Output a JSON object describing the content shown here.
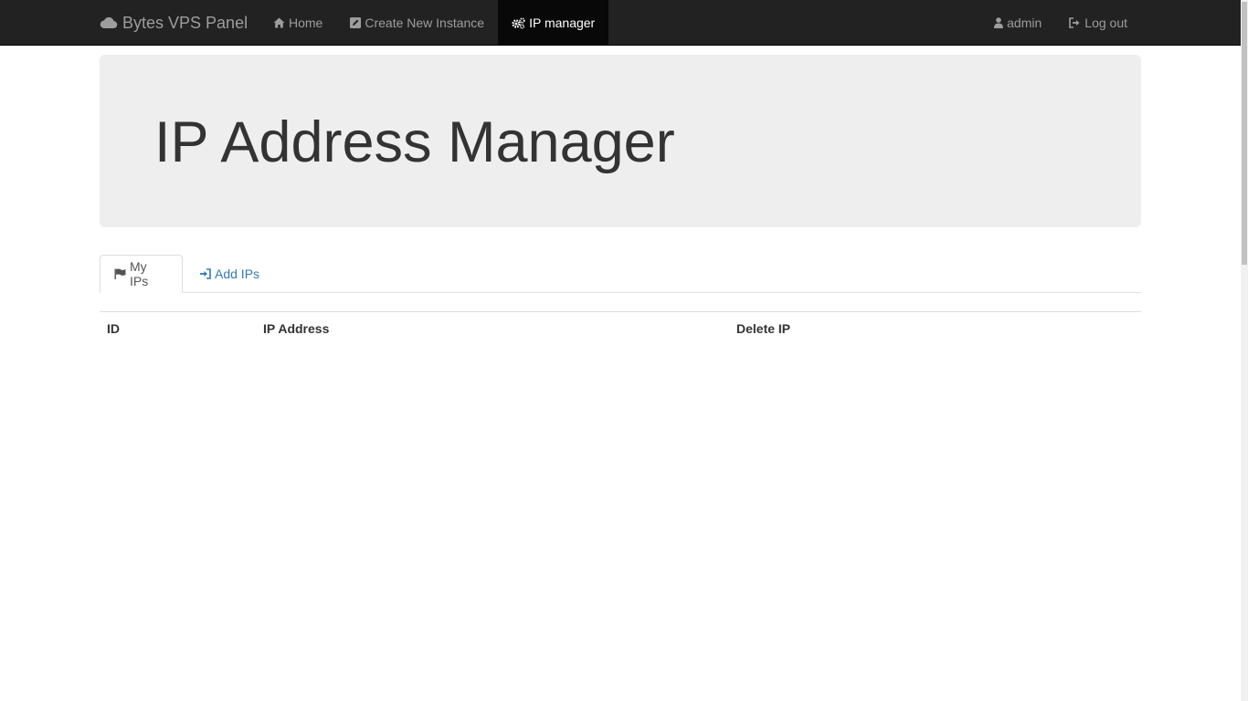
{
  "navbar": {
    "brand": "Bytes VPS Panel",
    "brand_icon": "cloud-icon",
    "left_items": [
      {
        "label": "Home",
        "icon": "home-icon",
        "active": false
      },
      {
        "label": "Create New Instance",
        "icon": "edit-icon",
        "active": false
      },
      {
        "label": "IP manager",
        "icon": "cogs-icon",
        "active": true
      }
    ],
    "right_items": [
      {
        "label": "admin",
        "icon": "user-icon"
      },
      {
        "label": "Log out",
        "icon": "log-out-icon"
      }
    ]
  },
  "jumbotron": {
    "title": "IP Address Manager"
  },
  "tabs": [
    {
      "label": "My IPs",
      "icon": "flag-icon",
      "active": true
    },
    {
      "label": "Add IPs",
      "icon": "log-in-icon",
      "active": false
    }
  ],
  "table": {
    "headers": [
      "ID",
      "IP Address",
      "Delete IP"
    ],
    "rows": []
  },
  "colors": {
    "navbar_bg": "#222222",
    "navbar_active_bg": "#080808",
    "nav_text": "#9d9d9d",
    "link": "#337ab7",
    "jumbotron_bg": "#eeeeee"
  }
}
